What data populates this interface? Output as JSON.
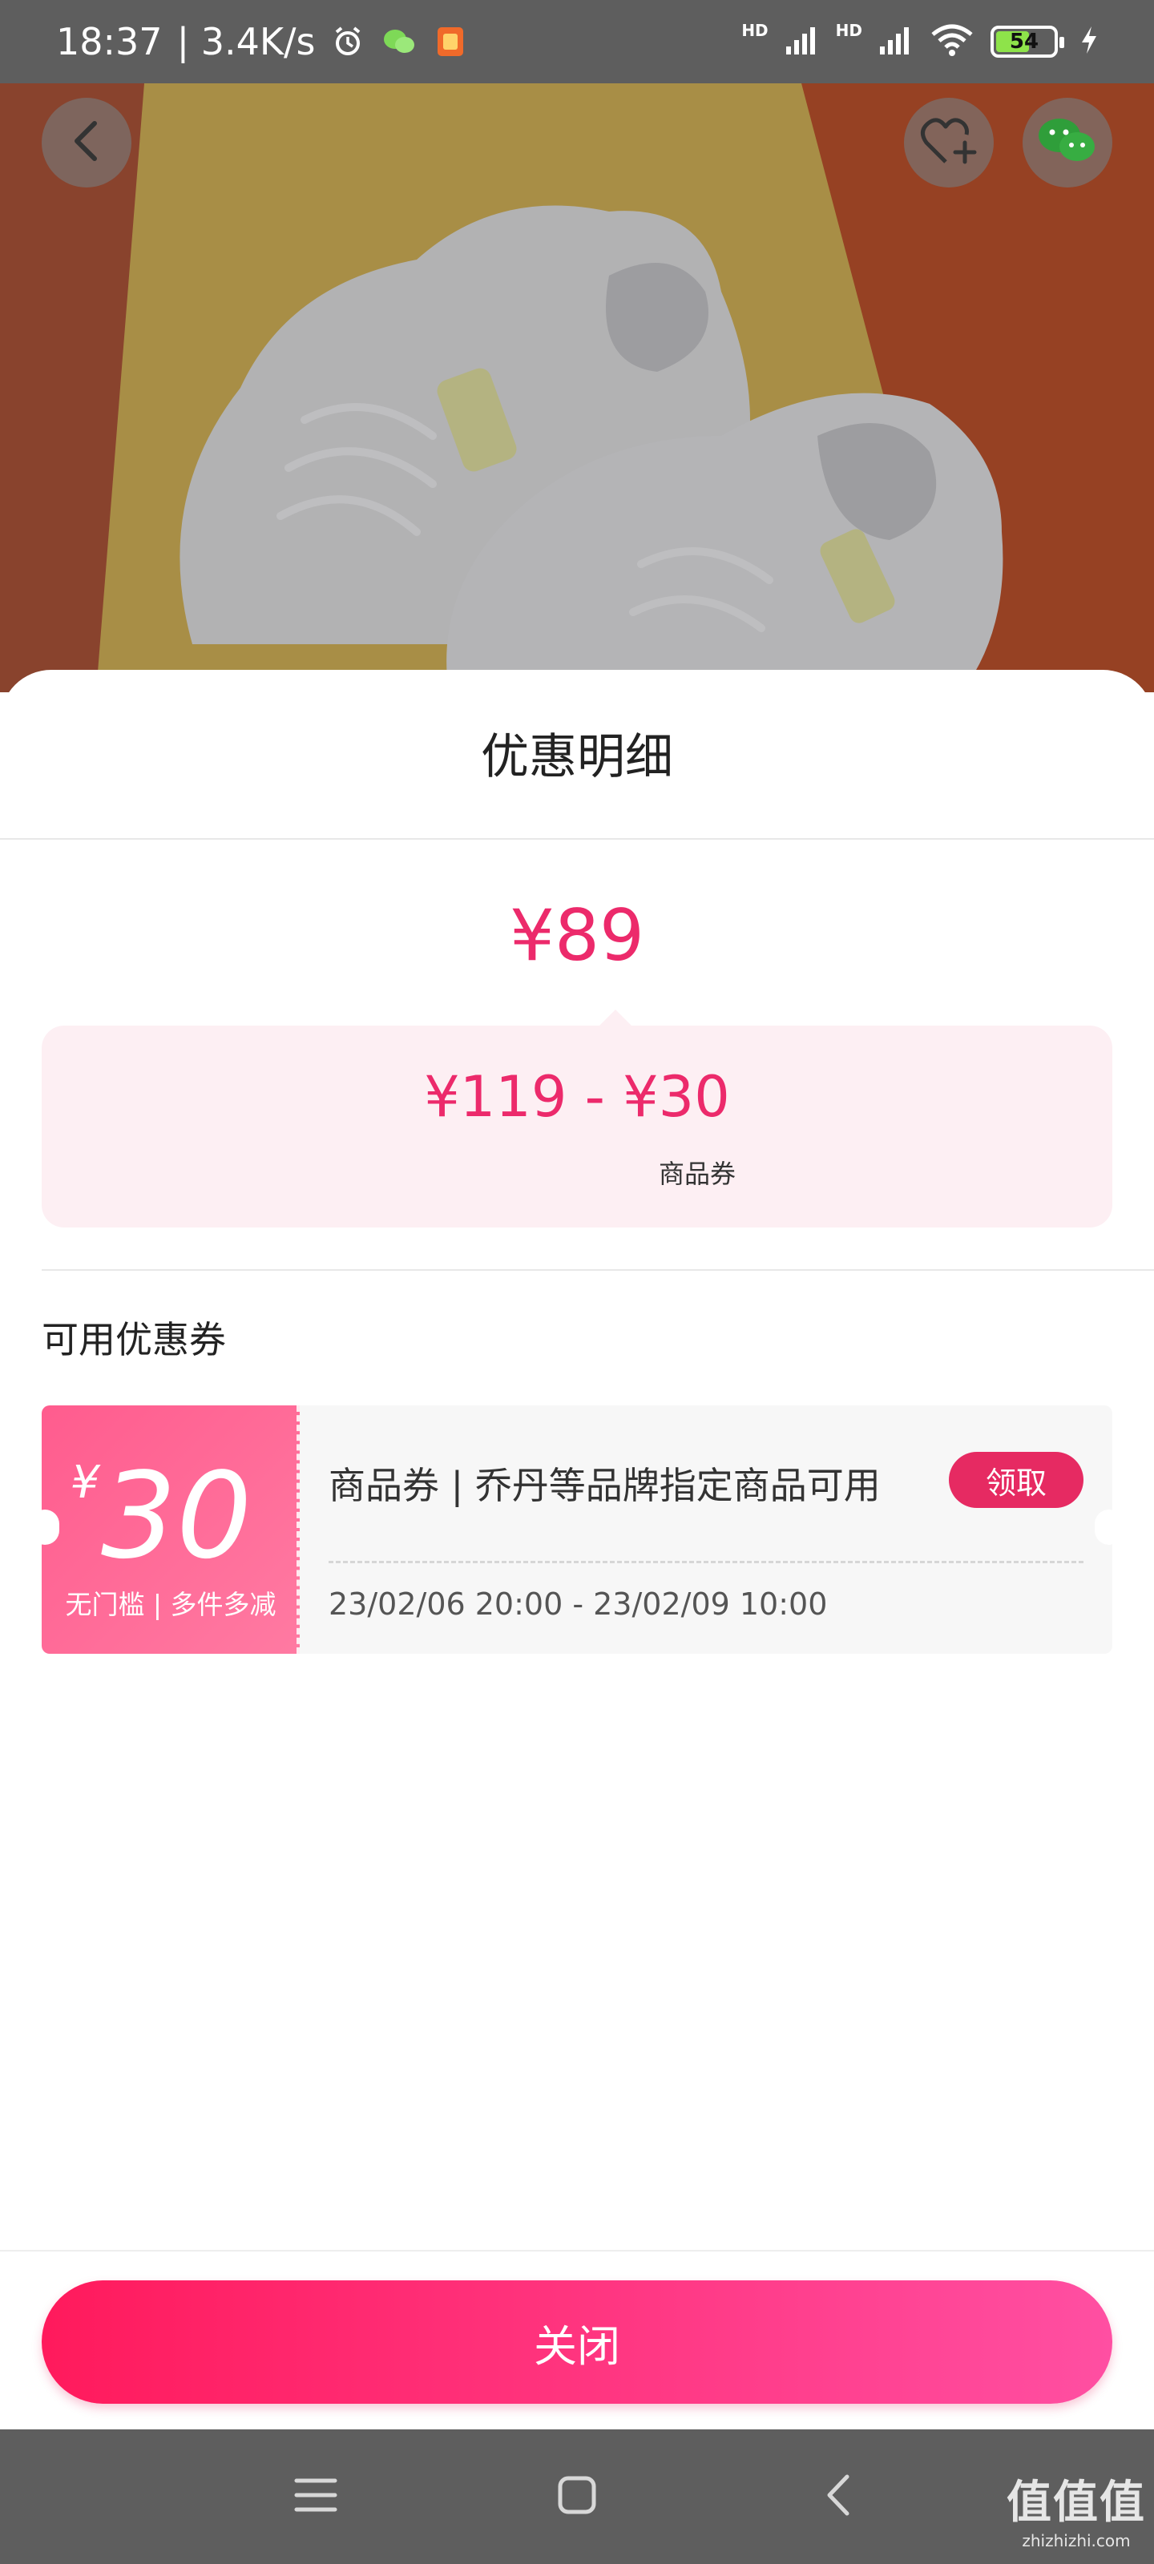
{
  "status_bar": {
    "time": "18:37",
    "speed": "| 3.4K/s",
    "network_1": "HD",
    "network_2": "HD",
    "battery": "54"
  },
  "hero": {
    "back_icon": "chevron-left-icon",
    "favorite_icon": "heart-plus-icon",
    "share_icon": "wechat-icon"
  },
  "sheet": {
    "title": "优惠明细",
    "final_price": "¥89",
    "formula": "¥119 - ¥30",
    "formula_label": "商品券",
    "section_title": "可用优惠券"
  },
  "coupon": {
    "currency": "¥",
    "amount": "30",
    "condition": "无门槛 | 多件多减",
    "description": "商品券 | 乔丹等品牌指定商品可用",
    "claim_label": "领取",
    "validity": "23/02/06 20:00 - 23/02/09 10:00"
  },
  "actions": {
    "close_label": "关闭"
  },
  "nav": {
    "menu_icon": "menu-icon",
    "home_icon": "home-icon",
    "back_icon": "back-icon"
  },
  "watermark": {
    "main": "值值值",
    "sub": "zhizhizhi.com"
  },
  "colors": {
    "accent": "#ec2a6b",
    "button_start": "#ff1a5c",
    "button_end": "#ff4fa2",
    "coupon_bg": "#fdeff3"
  }
}
